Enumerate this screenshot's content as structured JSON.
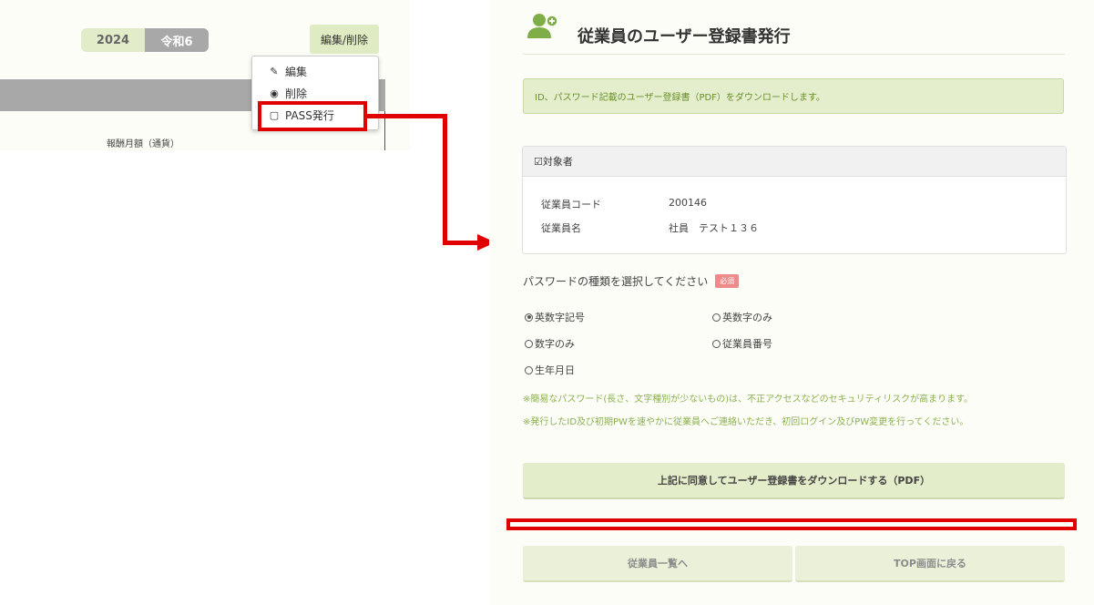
{
  "left": {
    "year": "2024",
    "era": "令和6",
    "edit_delete_button": "編集/削除",
    "salary_label": "報酬月額（通貨）",
    "menu": [
      {
        "label": "編集",
        "icon": "pencil-icon"
      },
      {
        "label": "削除",
        "icon": "eye-icon"
      },
      {
        "label": "PASS発行",
        "icon": "square-icon"
      }
    ]
  },
  "right": {
    "title": "従業員のユーザー登録書発行",
    "info": "ID、パスワード記載のユーザー登録書（PDF）をダウンロードします。",
    "card": {
      "header": "対象者",
      "rows": [
        {
          "label": "従業員コード",
          "value": "200146"
        },
        {
          "label": "従業員名",
          "value": "社員　テスト１３６"
        }
      ]
    },
    "password_label": "パスワードの種類を選択してください",
    "required_badge": "必須",
    "options": [
      {
        "label": "英数字記号",
        "checked": true
      },
      {
        "label": "英数字のみ",
        "checked": false
      },
      {
        "label": "数字のみ",
        "checked": false
      },
      {
        "label": "従業員番号",
        "checked": false
      },
      {
        "label": "生年月日",
        "checked": false
      }
    ],
    "notes": [
      "※簡易なパスワード(長さ、文字種別が少ないもの)は、不正アクセスなどのセキュリティリスクが高まります。",
      "※発行したID及び初期PWを速やかに従業員へご連絡いただき、初回ログイン及びPW変更を行ってください。"
    ],
    "download_button": "上記に同意してユーザー登録書をダウンロードする（PDF）",
    "back_list_button": "従業員一覧へ",
    "back_top_button": "TOP画面に戻る"
  },
  "colors": {
    "accent_green": "#7fae49",
    "highlight_red": "#e00000"
  }
}
